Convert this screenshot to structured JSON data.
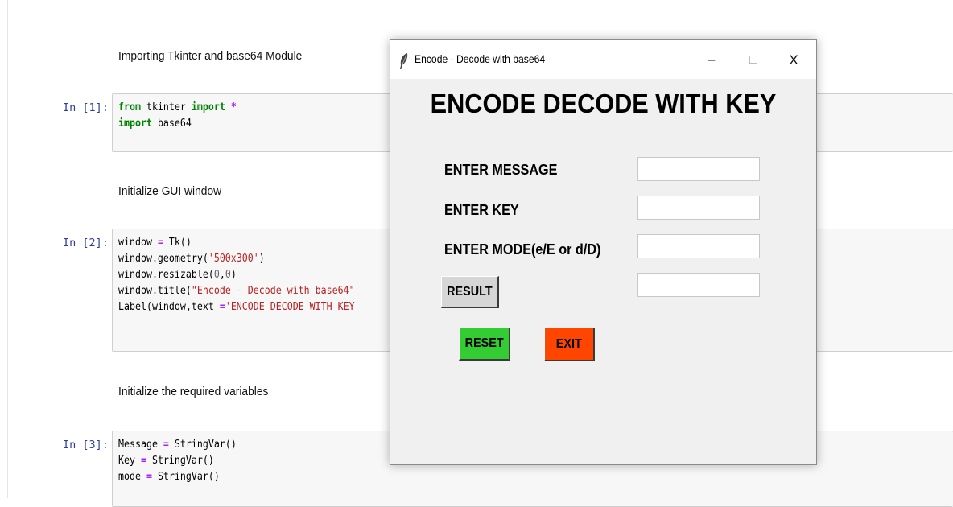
{
  "notebook": {
    "md1": "Importing Tkinter and base64 Module",
    "md2": "Initialize GUI window",
    "md3": "Initialize the required variables",
    "prompts": [
      "In [1]:",
      "In [2]:",
      "In [3]:"
    ]
  },
  "code": {
    "c1_l1": [
      "from",
      " tkinter ",
      "import",
      " *"
    ],
    "c1_l2": [
      "import",
      " base64"
    ],
    "c2_l1": [
      "window ",
      "=",
      " Tk()"
    ],
    "c2_l2": [
      "window.geometry(",
      "'500x300'",
      ")"
    ],
    "c2_l3": [
      "window.resizable(",
      "0",
      ",",
      "0",
      ")"
    ],
    "c2_l4": [
      "window.title(",
      "\"Encode - Decode with base64\""
    ],
    "c2_l5": [
      "Label(window,text ",
      "=",
      "'ENCODE DECODE WITH KEY"
    ],
    "c3_l1": [
      "Message ",
      "=",
      " StringVar()"
    ],
    "c3_l2": [
      "Key ",
      "=",
      " StringVar()"
    ],
    "c3_l3": [
      "mode ",
      "=",
      " StringVar()"
    ]
  },
  "tk_window": {
    "title": "Encode - Decode with base64",
    "controls": {
      "minimize": "–",
      "maximize": "□",
      "close": "X"
    },
    "heading": "ENCODE DECODE WITH KEY",
    "labels": {
      "message": "ENTER MESSAGE",
      "key": "ENTER KEY",
      "mode": "ENTER MODE(e/E or d/D)"
    },
    "entries": {
      "message": "",
      "key": "",
      "mode": "",
      "result": ""
    },
    "buttons": {
      "result": "RESULT",
      "reset": "RESET",
      "exit": "EXIT"
    },
    "colors": {
      "reset_bg": "#33cc33",
      "exit_bg": "#ff4500",
      "result_bg": "#d6d6d6"
    },
    "icon": "feather-icon"
  }
}
